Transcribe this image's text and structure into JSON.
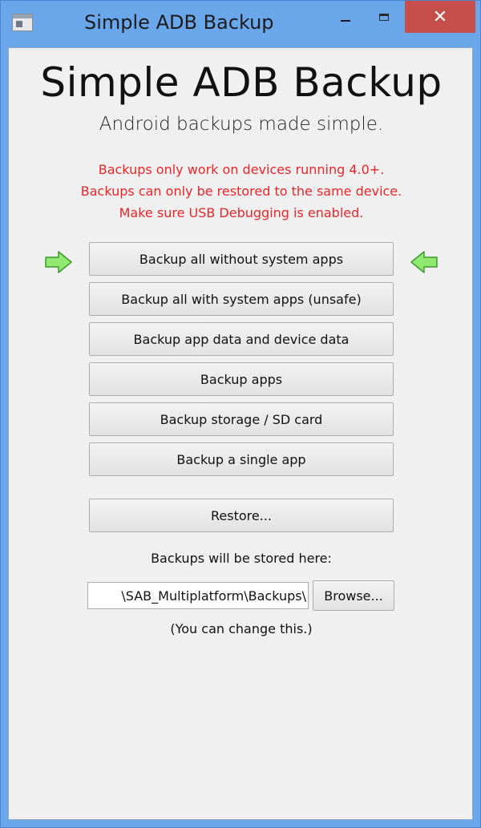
{
  "window": {
    "title": "Simple ADB Backup",
    "app_icon": "window-app-icon",
    "controls": {
      "minimize_icon": "minimize-icon",
      "maximize_icon": "maximize-icon",
      "close_glyph": "✕"
    },
    "close_color": "#c74f4a",
    "frame_color": "#6aa6ea"
  },
  "header": {
    "title": "Simple ADB Backup",
    "subtitle": "Android backups made simple."
  },
  "warnings": {
    "color": "#e8262a",
    "lines": [
      "Backups only work on devices running 4.0+.",
      "Backups can only be restored to the same device.",
      "Make sure USB Debugging is enabled."
    ]
  },
  "actions": {
    "backup_no_system": "Backup all without system apps",
    "backup_with_system": "Backup all with system apps (unsafe)",
    "backup_app_and_device_data": "Backup app data and device data",
    "backup_apps": "Backup apps",
    "backup_storage": "Backup storage / SD card",
    "backup_single_app": "Backup a single app",
    "restore": "Restore..."
  },
  "recommended_indicator": {
    "left_icon": "arrow-right-icon",
    "right_icon": "arrow-left-icon",
    "color": "#8fe870"
  },
  "storage": {
    "label": "Backups will be stored here:",
    "path_value": "\\SAB_Multiplatform\\Backups\\",
    "browse_label": "Browse...",
    "note": "(You can change this.)"
  }
}
